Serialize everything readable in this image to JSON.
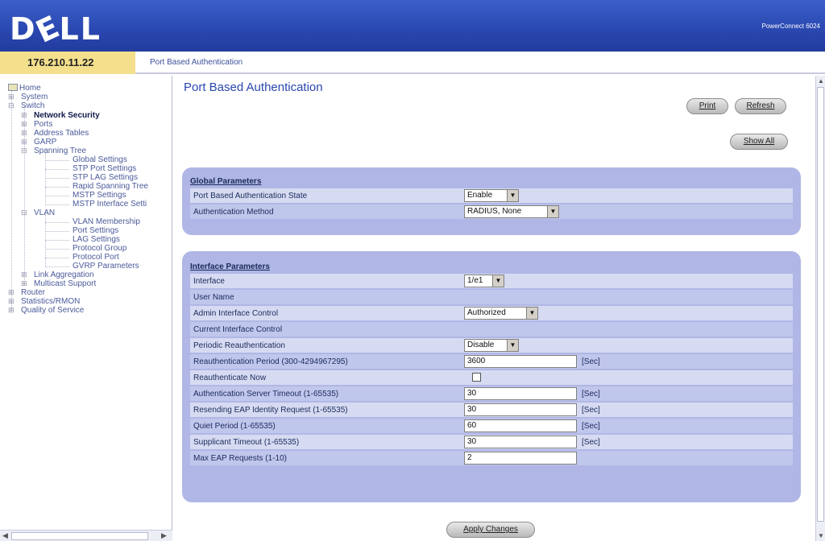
{
  "header": {
    "logo": "DELL",
    "model": "PowerConnect 6024"
  },
  "address": {
    "ip": "176.210.11.22",
    "breadcrumb": "Port Based Authentication"
  },
  "tree": {
    "items": [
      {
        "label": "Home"
      },
      {
        "label": "System"
      },
      {
        "label": "Switch"
      },
      {
        "label": "Network Security"
      },
      {
        "label": "Ports"
      },
      {
        "label": "Address Tables"
      },
      {
        "label": "GARP"
      },
      {
        "label": "Spanning Tree"
      },
      {
        "label": "Global Settings"
      },
      {
        "label": "STP Port Settings"
      },
      {
        "label": "STP LAG Settings"
      },
      {
        "label": "Rapid Spanning Tree"
      },
      {
        "label": "MSTP Settings"
      },
      {
        "label": "MSTP Interface Setti"
      },
      {
        "label": "VLAN"
      },
      {
        "label": "VLAN Membership"
      },
      {
        "label": "Port Settings"
      },
      {
        "label": "LAG Settings"
      },
      {
        "label": "Protocol Group"
      },
      {
        "label": "Protocol Port"
      },
      {
        "label": "GVRP Parameters"
      },
      {
        "label": "Link Aggregation"
      },
      {
        "label": "Multicast Support"
      },
      {
        "label": "Router"
      },
      {
        "label": "Statistics/RMON"
      },
      {
        "label": "Quality of Service"
      }
    ]
  },
  "main": {
    "title": "Port Based Authentication",
    "buttons": {
      "print": "Print",
      "refresh": "Refresh",
      "show_all": "Show All",
      "apply": "Apply Changes"
    },
    "global": {
      "heading": "Global Parameters",
      "state_label": "Port Based Authentication State",
      "state_value": "Enable",
      "method_label": "Authentication Method",
      "method_value": "RADIUS, None"
    },
    "iface": {
      "heading": "Interface Parameters",
      "interface_label": "Interface",
      "interface_value": "1/e1",
      "user_label": "User Name",
      "admin_label": "Admin Interface Control",
      "admin_value": "Authorized",
      "current_label": "Current Interface Control",
      "periodic_label": "Periodic Reauthentication",
      "periodic_value": "Disable",
      "reauth_period_label": "Reauthentication Period (300-4294967295)",
      "reauth_period_value": "3600",
      "reauth_now_label": "Reauthenticate Now",
      "server_timeout_label": "Authentication Server Timeout (1-65535)",
      "server_timeout_value": "30",
      "resend_label": "Resending EAP Identity Request (1-65535)",
      "resend_value": "30",
      "quiet_label": "Quiet Period (1-65535)",
      "quiet_value": "60",
      "supplicant_label": "Supplicant Timeout (1-65535)",
      "supplicant_value": "30",
      "max_eap_label": "Max EAP Requests (1-10)",
      "max_eap_value": "2",
      "unit": "[Sec]"
    }
  },
  "colors": {
    "header": "#2a47b0",
    "panel": "#b0b7e6",
    "ip_bg": "#f3df8c"
  }
}
